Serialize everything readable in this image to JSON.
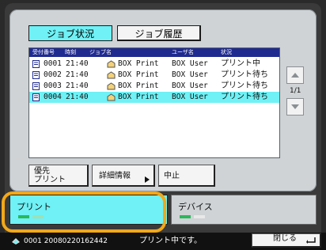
{
  "tabs": {
    "active": "ジョブ状況",
    "inactive": "ジョブ履歴"
  },
  "list": {
    "headers": [
      "受付番号",
      "時刻",
      "ジョブ名",
      "ユーザ名",
      "状況"
    ],
    "rows": [
      {
        "id": "0001",
        "time": "21:40",
        "job": "BOX Print",
        "user": "BOX User",
        "status": "プリント中"
      },
      {
        "id": "0002",
        "time": "21:40",
        "job": "BOX Print",
        "user": "BOX User",
        "status": "プリント待ち"
      },
      {
        "id": "0003",
        "time": "21:40",
        "job": "BOX Print",
        "user": "BOX User",
        "status": "プリント待ち"
      },
      {
        "id": "0004",
        "time": "21:40",
        "job": "BOX Print",
        "user": "BOX User",
        "status": "プリント待ち"
      }
    ],
    "page": "1/1"
  },
  "buttons": {
    "priority_line1": "優先",
    "priority_line2": "プリント",
    "details": "詳細情報",
    "cancel": "中止",
    "close": "閉じる"
  },
  "bottom_tabs": {
    "print": "プリント",
    "device": "デバイス"
  },
  "statusbar": {
    "job_info": "0001 20080220162442",
    "message": "プリント中です。"
  },
  "colors": {
    "highlight": "#6ff1f5",
    "header": "#1f2b8f",
    "annotation": "#f2a818"
  }
}
